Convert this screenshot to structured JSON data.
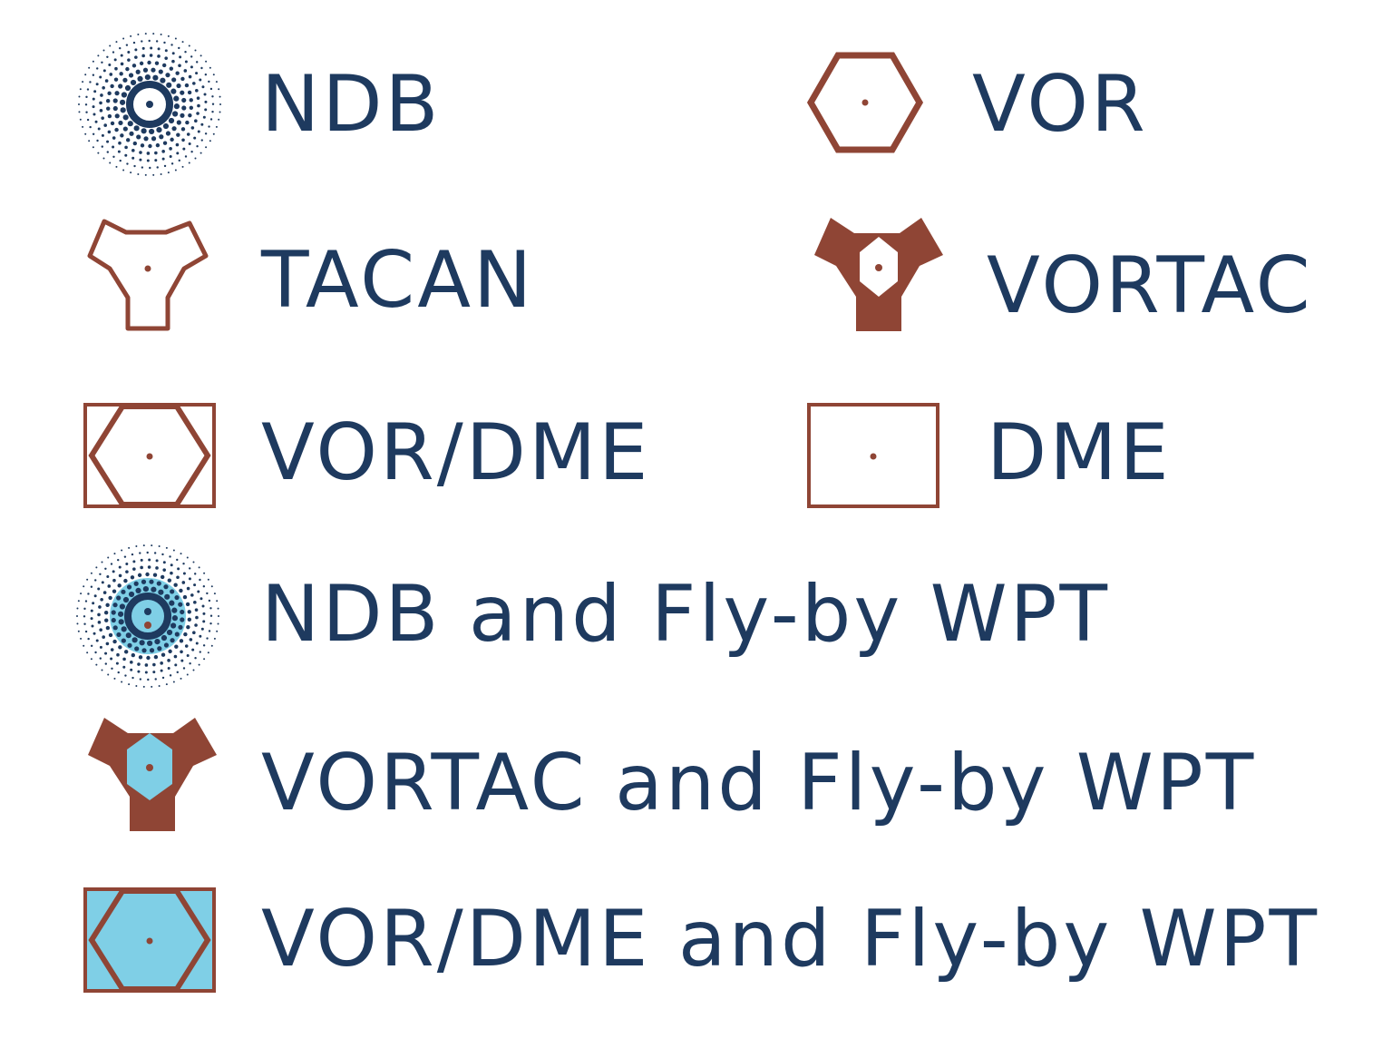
{
  "colors": {
    "navy": "#1e3a5f",
    "rust": "#8f4535",
    "light_blue": "#7fcfe6",
    "background": "#ffffff"
  },
  "legend": {
    "items": [
      {
        "label": "NDB",
        "icon": "ndb-symbol"
      },
      {
        "label": "VOR",
        "icon": "vor-symbol"
      },
      {
        "label": "TACAN",
        "icon": "tacan-symbol"
      },
      {
        "label": "VORTAC",
        "icon": "vortac-symbol"
      },
      {
        "label": "VOR/DME",
        "icon": "vor-dme-symbol"
      },
      {
        "label": "DME",
        "icon": "dme-symbol"
      },
      {
        "label": "NDB and Fly-by WPT",
        "icon": "ndb-flyby-waypoint-symbol"
      },
      {
        "label": "VORTAC and Fly-by WPT",
        "icon": "vortac-flyby-waypoint-symbol"
      },
      {
        "label": "VOR/DME and Fly-by WPT",
        "icon": "vor-dme-flyby-waypoint-symbol"
      }
    ]
  }
}
